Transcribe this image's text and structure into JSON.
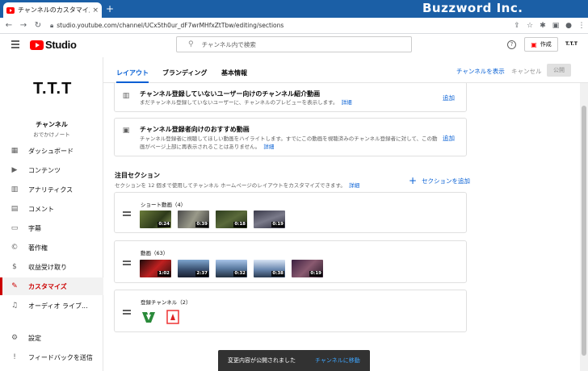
{
  "browser": {
    "tab_title": "チャンネルのカスタマイズ - YouTube Studio",
    "tab_close": "×",
    "new_tab": "+",
    "url": "studio.youtube.com/channel/UCx5th0ur_dF7wrMHfxZtTbw/editing/sections",
    "watermark": "Buzzword Inc."
  },
  "studio": {
    "logo_text": "Studio",
    "search_placeholder": "チャンネル内で検索",
    "create_label": "作成",
    "avatar_text": "T.T.T"
  },
  "sidebar": {
    "channel_logo": "T.T.T",
    "channel_name": "チャンネル",
    "channel_sub": "おでかけノート",
    "items": [
      {
        "label": "ダッシュボード",
        "icon": "dashboard-icon"
      },
      {
        "label": "コンテンツ",
        "icon": "content-icon"
      },
      {
        "label": "アナリティクス",
        "icon": "analytics-icon"
      },
      {
        "label": "コメント",
        "icon": "comment-icon"
      },
      {
        "label": "字幕",
        "icon": "subtitles-icon"
      },
      {
        "label": "著作権",
        "icon": "copyright-icon"
      },
      {
        "label": "収益受け取り",
        "icon": "dollar-icon"
      },
      {
        "label": "カスタマイズ",
        "icon": "magic-wand-icon"
      },
      {
        "label": "オーディオ ライブ...",
        "icon": "audio-library-icon"
      },
      {
        "label": "設定",
        "icon": "settings-icon"
      },
      {
        "label": "フィードバックを送信",
        "icon": "feedback-icon"
      }
    ]
  },
  "tabs": [
    {
      "label": "レイアウト"
    },
    {
      "label": "ブランディング"
    },
    {
      "label": "基本情報"
    }
  ],
  "actions": {
    "show_channel": "チャンネルを表示",
    "cancel": "キャンセル",
    "publish": "公開"
  },
  "spotlight": {
    "trailer_title": "チャンネル登録していないユーザー向けのチャンネル紹介動画",
    "trailer_desc": "まだチャンネル登録していないユーザーに、チャンネルのプレビューを表示します。",
    "trailer_link": "詳細",
    "trailer_add": "追加",
    "featured_title": "チャンネル登録者向けのおすすめ動画",
    "featured_desc_1": "チャンネル登録者に視聴してほしい動画をハイライトします。すでにこの動画を視聴済みのチャンネル登録者に対して、この動",
    "featured_desc_2": "画がページ上部に再表示されることはありません。",
    "featured_link": "詳細",
    "featured_add": "追加"
  },
  "featured_sections": {
    "title": "注目セクション",
    "desc": "セクションを 12 個まで使用してチャンネル ホームページのレイアウトをカスタマイズできます。",
    "link": "詳細",
    "add_label": "セクションを追加"
  },
  "sections": [
    {
      "title": "ショート動画（4）",
      "durations": [
        "0:24",
        "0:39",
        "0:18",
        "0:19"
      ]
    },
    {
      "title": "動画（63）",
      "durations": [
        "1:02",
        "2:37",
        "0:32",
        "0:38",
        "0:19"
      ]
    },
    {
      "title": "登録チャンネル（2）"
    }
  ],
  "toast": {
    "message": "変更内容が公開されました",
    "action": "チャンネルに移動"
  }
}
